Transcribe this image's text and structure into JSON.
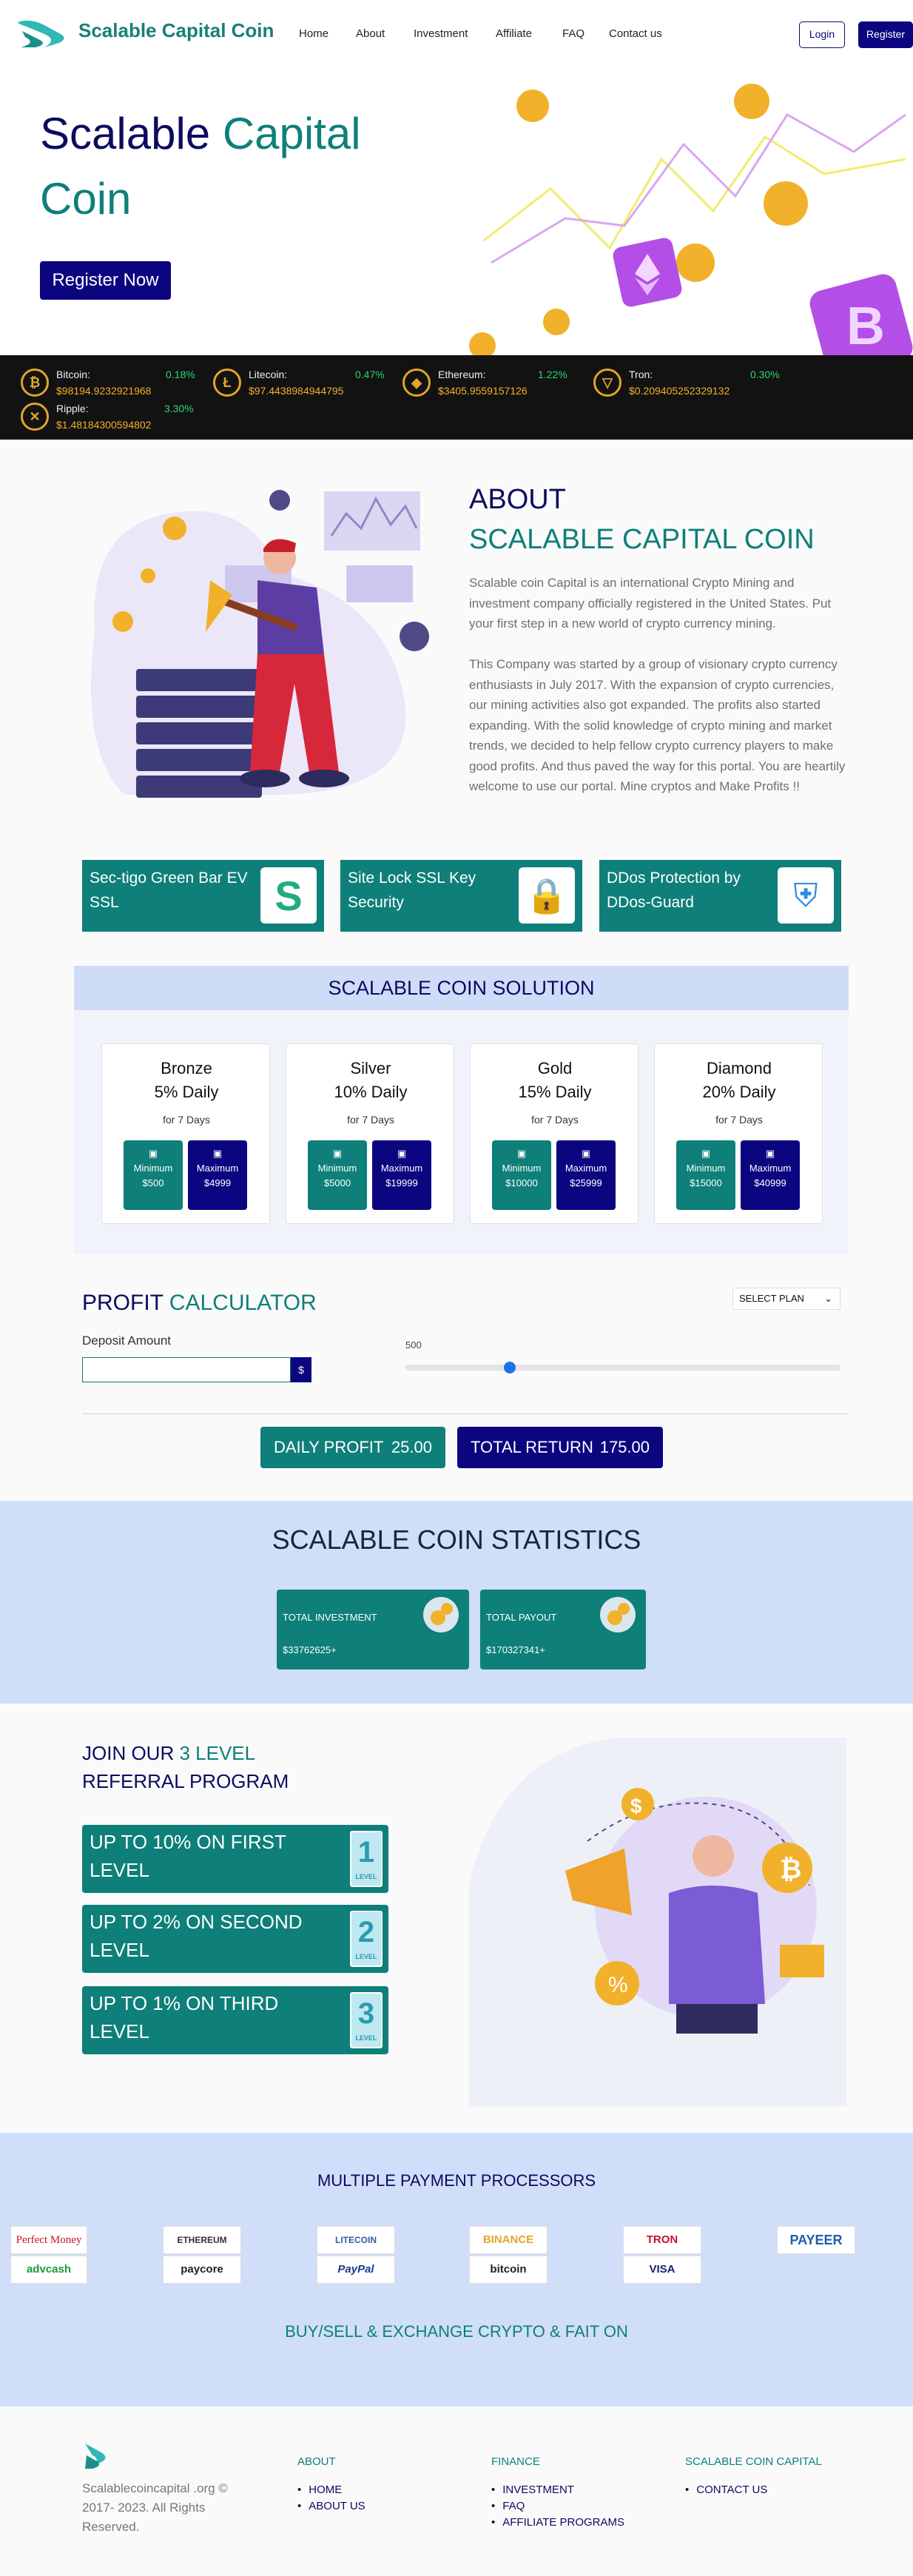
{
  "header": {
    "brand": "Scalable Capital Coin",
    "nav": [
      "Home",
      "About",
      "Investment",
      "Affiliate",
      "FAQ",
      "Contact us"
    ],
    "login": "Login",
    "register": "Register"
  },
  "hero": {
    "title_1": "Scalable",
    "title_2": "Capital",
    "title_3": "Coin",
    "cta": "Register Now"
  },
  "ticker": [
    {
      "name": "Bitcoin:",
      "pct": "0.18%",
      "price": "$98194.9232921968",
      "icon": "bitcoin-icon"
    },
    {
      "name": "Litecoin:",
      "pct": "0.47%",
      "price": "$97.4438984944795",
      "icon": "litecoin-icon"
    },
    {
      "name": "Ethereum:",
      "pct": "1.22%",
      "price": "$3405.9559157126",
      "icon": "ethereum-icon"
    },
    {
      "name": "Tron:",
      "pct": "0.30%",
      "price": "$0.209405252329132",
      "icon": "tron-icon"
    },
    {
      "name": "Ripple:",
      "pct": "3.30%",
      "price": "$1.48184300594802",
      "icon": "ripple-icon"
    }
  ],
  "about": {
    "heading_1": "ABOUT",
    "heading_2": "SCALABLE CAPITAL COIN",
    "para_1": "Scalable coin Capital is an international Crypto Mining and investment company officially registered in the United States. Put your first step in a new world of crypto currency mining.",
    "para_2": "This Company was started by a group of visionary crypto currency enthusiasts in July 2017. With the expansion of crypto currencies, our mining activities also got expanded. The profits also started expanding. With the solid knowledge of crypto mining and market trends, we decided to help fellow crypto currency players to make good profits. And thus paved the way for this portal. You are heartily welcome to use our portal. Mine cryptos and Make Profits !!"
  },
  "security": [
    {
      "label": "Sec-tigo Green Bar EV SSL",
      "icon": "sectigo-icon"
    },
    {
      "label": "Site Lock SSL Key Security",
      "icon": "sitelock-icon"
    },
    {
      "label": "DDos Protection by DDos-Guard",
      "icon": "ddos-guard-icon"
    }
  ],
  "solution": {
    "title": "SCALABLE COIN SOLUTION",
    "plans": [
      {
        "name": "Bronze",
        "pct": "5% Daily",
        "days": "for 7 Days",
        "min": "Minimum",
        "min_val": "$500",
        "max": "Maximum",
        "max_val": "$4999"
      },
      {
        "name": "Silver",
        "pct": "10% Daily",
        "days": "for 7 Days",
        "min": "Minimum",
        "min_val": "$5000",
        "max": "Maximum",
        "max_val": "$19999"
      },
      {
        "name": "Gold",
        "pct": "15% Daily",
        "days": "for 7 Days",
        "min": "Minimum",
        "min_val": "$10000",
        "max": "Maximum",
        "max_val": "$25999"
      },
      {
        "name": "Diamond",
        "pct": "20% Daily",
        "days": "for 7 Days",
        "min": "Minimum",
        "min_val": "$15000",
        "max": "Maximum",
        "max_val": "$40999"
      }
    ]
  },
  "calculator": {
    "title_1": "PROFIT",
    "title_2": "CALCULATOR",
    "select_plan": "SELECT PLAN",
    "deposit_label": "Deposit Amount",
    "currency": "$",
    "slider_value": "500",
    "slider_fraction": 0.24,
    "daily_label": "DAILY PROFIT",
    "daily_value": "25.00",
    "total_label": "TOTAL RETURN",
    "total_value": "175.00"
  },
  "stats": {
    "title": "SCALABLE COIN STATISTICS",
    "cards": [
      {
        "label": "TOTAL INVESTMENT",
        "value": "$33762625+"
      },
      {
        "label": "TOTAL PAYOUT",
        "value": "$170327341+"
      }
    ]
  },
  "referral": {
    "heading_1": "JOIN OUR",
    "heading_2": "3 LEVEL",
    "heading_3": "REFERRAL PROGRAM",
    "levels": [
      {
        "text": "UP TO 10% ON FIRST LEVEL",
        "num": "1",
        "badge": "LEVEL"
      },
      {
        "text": "UP TO 2% ON SECOND LEVEL",
        "num": "2",
        "badge": "LEVEL"
      },
      {
        "text": "UP TO 1% ON THIRD LEVEL",
        "num": "3",
        "badge": "LEVEL"
      }
    ]
  },
  "payments": {
    "title": "MULTIPLE PAYMENT PROCESSORS",
    "logos": [
      "Perfect Money",
      "advcash",
      "ETHEREUM",
      "paycore",
      "LITECOIN",
      "PayPal",
      "BINANCE",
      "bitcoin",
      "TRON",
      "VISA",
      "PAYEER"
    ],
    "tagline": "BUY/SELL & EXCHANGE CRYPTO & FAIT ON"
  },
  "footer": {
    "copyright": "Scalablecoincapital .org © 2017- 2023. All Rights Reserved.",
    "cols": [
      {
        "head": "ABOUT",
        "items": [
          "HOME",
          "ABOUT US"
        ]
      },
      {
        "head": "FINANCE",
        "items": [
          "INVESTMENT",
          "FAQ",
          "AFFILIATE PROGRAMS"
        ]
      },
      {
        "head": "SCALABLE COIN CAPITAL",
        "items": [
          "CONTACT US"
        ]
      }
    ]
  },
  "colors": {
    "teal": "#0e7f79",
    "navy": "#0b0680",
    "ticker_bg": "#121212",
    "light_blue": "#cfdcf8"
  }
}
